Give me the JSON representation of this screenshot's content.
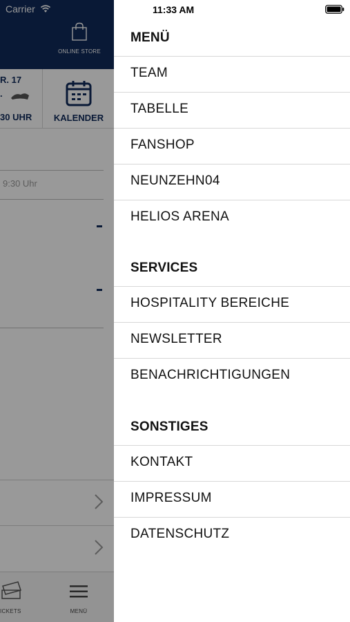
{
  "status_bar": {
    "carrier": "Carrier",
    "time": "11:33 AM"
  },
  "background": {
    "online_store_label": "ONLINE STORE",
    "match": {
      "line1": "R. 17",
      "line2": ".",
      "line3": "30 UHR"
    },
    "calendar_label": "KALENDER",
    "time_text": "9:30 Uhr",
    "tabbar": {
      "tickets_label": "ICKETS",
      "menu_label": "MENÜ"
    }
  },
  "menu": {
    "sections": [
      {
        "title": "MENÜ",
        "items": [
          "TEAM",
          "TABELLE",
          "FANSHOP",
          "NEUNZEHN04",
          "HELIOS ARENA"
        ]
      },
      {
        "title": "SERVICES",
        "items": [
          "HOSPITALITY BEREICHE",
          "NEWSLETTER",
          "BENACHRICHTIGUNGEN"
        ]
      },
      {
        "title": "SONSTIGES",
        "items": [
          "KONTAKT",
          "IMPRESSUM",
          "DATENSCHUTZ"
        ]
      }
    ]
  },
  "colors": {
    "brand_navy": "#0f2a5a",
    "overlay": "rgba(0,0,0,0.40)"
  }
}
